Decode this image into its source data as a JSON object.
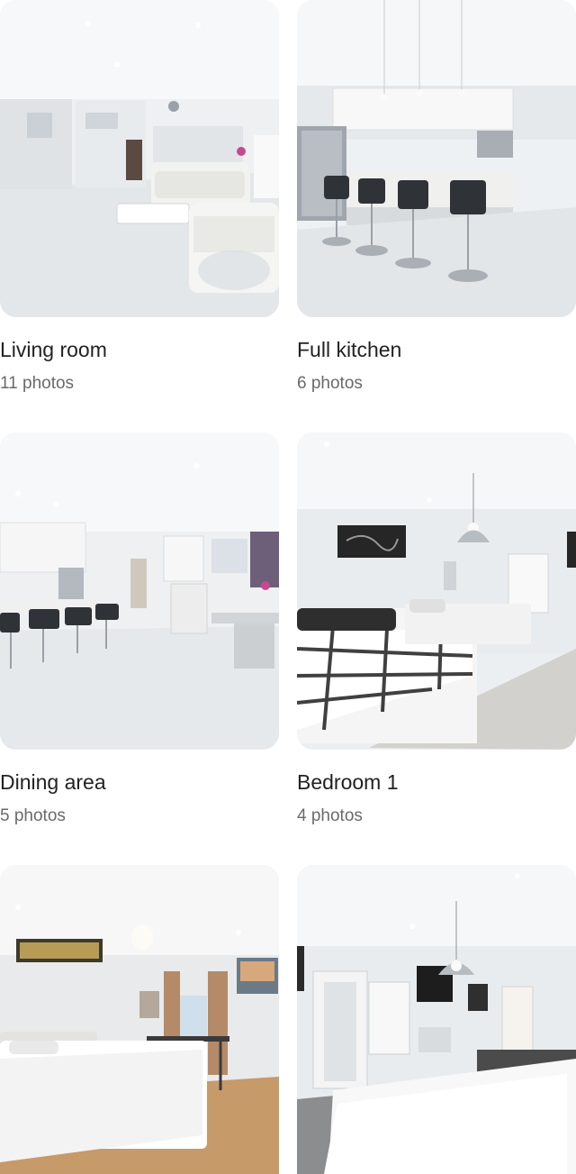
{
  "rooms": [
    {
      "title": "Living room",
      "count": "11 photos"
    },
    {
      "title": "Full kitchen",
      "count": "6 photos"
    },
    {
      "title": "Dining area",
      "count": "5 photos"
    },
    {
      "title": "Bedroom 1",
      "count": "4 photos"
    },
    {
      "title": "",
      "count": ""
    },
    {
      "title": "",
      "count": ""
    }
  ]
}
